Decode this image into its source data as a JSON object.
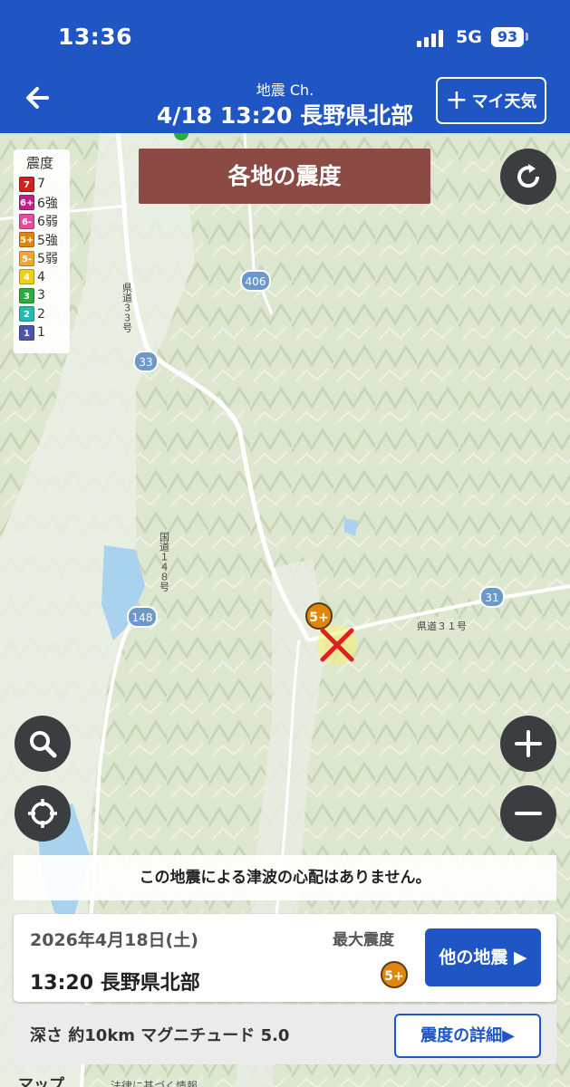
{
  "status": {
    "time": "13:36",
    "network": "5G",
    "battery": "93"
  },
  "header": {
    "channel": "地震 Ch.",
    "title": "4/18 13:20 長野県北部",
    "my_weather_label": "マイ天気"
  },
  "legend": {
    "title": "震度",
    "items": [
      {
        "badge": "7",
        "label": "7",
        "color": "#d41f1f"
      },
      {
        "badge": "6+",
        "label": "6強",
        "color": "#c41f88"
      },
      {
        "badge": "6-",
        "label": "6弱",
        "color": "#e24e9e"
      },
      {
        "badge": "5+",
        "label": "5強",
        "color": "#e0860f"
      },
      {
        "badge": "5-",
        "label": "5弱",
        "color": "#f2a62f"
      },
      {
        "badge": "4",
        "label": "4",
        "color": "#e8d213"
      },
      {
        "badge": "3",
        "label": "3",
        "color": "#2eab3d"
      },
      {
        "badge": "2",
        "label": "2",
        "color": "#29b8b0"
      },
      {
        "badge": "1",
        "label": "1",
        "color": "#4a55b0"
      }
    ]
  },
  "map": {
    "banner": "各地の震度",
    "road_labels": [
      "406",
      "33",
      "148",
      "31",
      "県道３３号",
      "国道１４８号",
      "県道３１号"
    ],
    "station_intensity": "5+",
    "epicenter_color": "#e02020"
  },
  "notice": "この地震による津波の心配はありません。",
  "quake": {
    "date": "2026年4月18日(土)",
    "time_place": "13:20 長野県北部",
    "max_label": "最大震度",
    "max_value": "5+",
    "other_button": "他の地震 ▶",
    "detail_text": "深さ 約10km マグニチュード 5.0",
    "detail_button": "震度の詳細▶"
  },
  "footer": {
    "maps_label": "マップ",
    "legal": "法律に基づく情報"
  },
  "colors": {
    "brand_blue": "#1f56c3",
    "banner_brown": "#8b4b44",
    "map_green": "#dfe8d2"
  }
}
